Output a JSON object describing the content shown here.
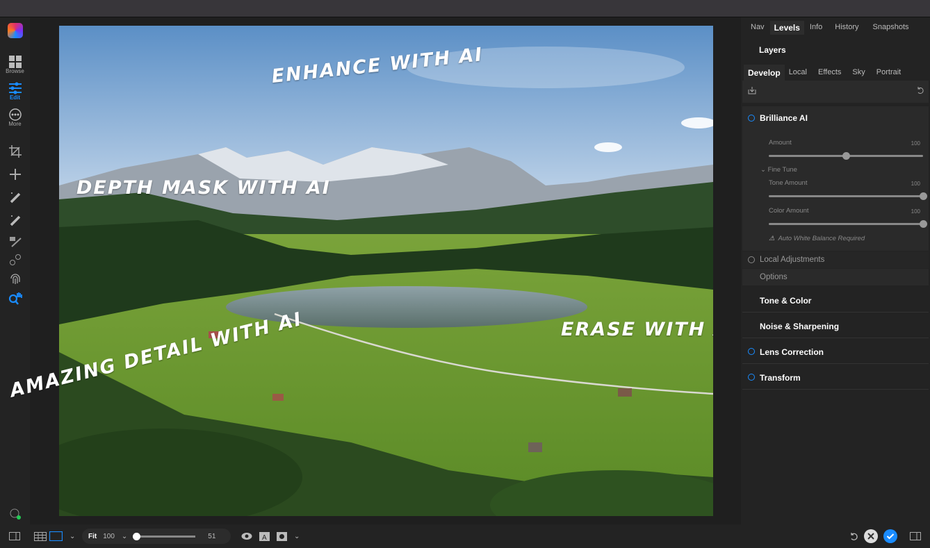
{
  "sidebar": {
    "items": [
      {
        "label": "Browse",
        "icon": "browse-icon"
      },
      {
        "label": "Edit",
        "icon": "sliders-icon",
        "active": true
      },
      {
        "label": "More",
        "icon": "more-icon"
      }
    ],
    "tools": [
      "crop-icon",
      "move-icon",
      "magic-wand-icon",
      "magic-wand-2-icon",
      "mask-brush-icon",
      "clone-icon",
      "fingerprint-icon",
      "zoom-hand-icon"
    ]
  },
  "canvas": {
    "annotations": [
      "ENHANCE WITH AI",
      "DEPTH MASK WITH AI",
      "ERASE WITH AI",
      "AMAZING DETAIL WITH AI"
    ]
  },
  "panel": {
    "tabs": [
      "Nav",
      "Levels",
      "Info",
      "History",
      "Snapshots"
    ],
    "active_tab": "Levels",
    "layers_label": "Layers",
    "subtabs": [
      "Develop",
      "Local",
      "Effects",
      "Sky",
      "Portrait"
    ],
    "brilliance": {
      "title": "Brilliance AI",
      "amount_label": "Amount",
      "amount_value": "100",
      "amount_pos": 0.5,
      "fine_tune": "Fine Tune",
      "tone_label": "Tone Amount",
      "tone_value": "100",
      "color_label": "Color Amount",
      "color_value": "100",
      "warning": "Auto White Balance Required"
    },
    "local_adjustments": "Local Adjustments",
    "options": "Options",
    "sections": [
      {
        "label": "Tone & Color",
        "ring": false
      },
      {
        "label": "Noise & Sharpening",
        "ring": false
      },
      {
        "label": "Lens Correction",
        "ring": true
      },
      {
        "label": "Transform",
        "ring": true
      }
    ]
  },
  "bottom": {
    "fit": "Fit",
    "zoom": "100",
    "slider_value": "51",
    "slider_pos": 0
  },
  "colors": {
    "accent": "#1a8cff",
    "status_green": "#22cc55"
  }
}
